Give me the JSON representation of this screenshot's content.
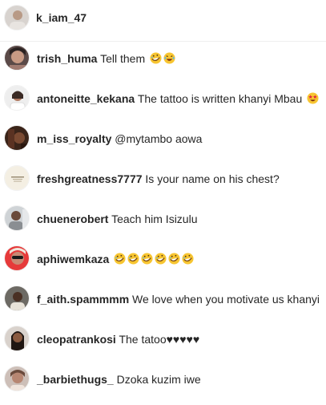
{
  "post": {
    "username": "k_iam_47"
  },
  "comments": [
    {
      "username": "trish_huma",
      "text": "Tell them",
      "emoji": [
        "rofl-emoji",
        "laughing-emoji"
      ]
    },
    {
      "username": "antoneitte_kekana",
      "text": "The tattoo is written khanyi Mbau",
      "emoji": [
        "star-struck-emoji"
      ]
    },
    {
      "username": "m_iss_royalty",
      "text": "@mytambo aowa",
      "emoji": []
    },
    {
      "username": "freshgreatness7777",
      "text": "Is your name on his chest?",
      "emoji": []
    },
    {
      "username": "chuenerobert",
      "text": "Teach him Isizulu",
      "emoji": []
    },
    {
      "username": "aphiwemkaza",
      "text": "",
      "emoji": [
        "rofl-emoji",
        "rofl-emoji",
        "rofl-emoji",
        "rofl-emoji",
        "rofl-emoji",
        "rofl-emoji"
      ]
    },
    {
      "username": "f_aith.spammmm",
      "text": "We love when you motivate us khanyi",
      "emoji": []
    },
    {
      "username": "cleopatrankosi",
      "text": "The tatoo♥♥♥♥♥",
      "emoji": []
    },
    {
      "username": "_barbiethugs_",
      "text": "Dzoka kuzim iwe",
      "emoji": []
    }
  ],
  "colors": {
    "text": "#262626",
    "divider": "#efefef",
    "emoji_face": "#f7c531"
  }
}
